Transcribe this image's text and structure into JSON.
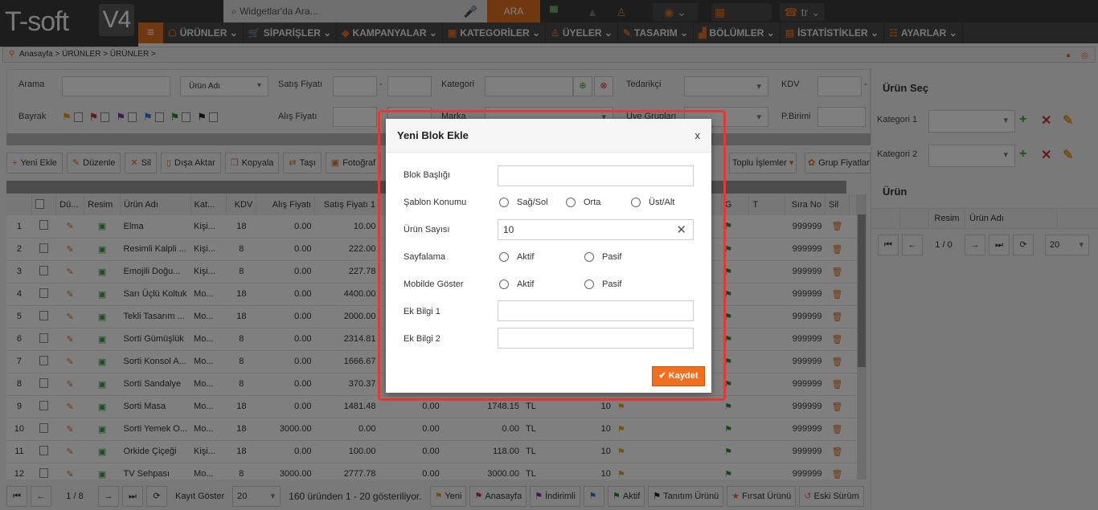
{
  "app": {
    "logo": "T-soft",
    "logo_version": "V4",
    "search_placeholder": "Widgetlar'da Ara...",
    "search_button": "ARA",
    "language": "tr"
  },
  "nav": [
    "ÜRÜNLER",
    "SİPARİŞLER",
    "KAMPANYALAR",
    "KATEGORİLER",
    "ÜYELER",
    "TASARIM",
    "BÖLÜMLER",
    "İSTATİSTİKLER",
    "AYARLAR"
  ],
  "breadcrumb": "Anasayfa > ÜRÜNLER > ÜRÜNLER >",
  "filters": {
    "arama": "Arama",
    "arama_select": "Ürün Adı",
    "satis_fiyati": "Satış Fiyatı",
    "kategori": "Kategori",
    "tedarikci": "Tedarikçi",
    "kdv": "KDV",
    "bayrak": "Bayrak",
    "alis_fiyati": "Alış Fiyatı",
    "marka": "Marka",
    "uye_gruplari": "Üye Grupları",
    "pbirimi": "P.Birimi",
    "dash": "-",
    "flag_colors": [
      "#e8a020",
      "#d03030",
      "#8a2aa8",
      "#2a7ad0",
      "#2e8b2e",
      "#222222"
    ]
  },
  "toolbar": [
    "Yeni Ekle",
    "Düzenle",
    "Sil",
    "Dışa Aktar",
    "Kopyala",
    "Taşı",
    "Fotoğraf"
  ],
  "toolbar_right": [
    "Toplu İşlemler",
    "Grup Fiyatlarını Göster"
  ],
  "table": {
    "headers": [
      "",
      "Dü...",
      "Resim",
      "Ürün Adı",
      "Kat...",
      "KDV",
      "Alış Fiyatı",
      "Satış Fiyatı 1",
      "",
      "",
      "",
      "",
      "",
      "G",
      "T",
      "Sıra No",
      "Sil"
    ],
    "rows": [
      {
        "n": "1",
        "name": "Elma",
        "kat": "Kişi...",
        "kdv": "18",
        "alis": "0.00",
        "satis": "10.00",
        "c1": "",
        "c2": "",
        "pb": "",
        "st": "",
        "sira": "999999"
      },
      {
        "n": "2",
        "name": "Resimli Kalpli ...",
        "kat": "Kişi...",
        "kdv": "8",
        "alis": "0.00",
        "satis": "222.00",
        "c1": "",
        "c2": "",
        "pb": "",
        "st": "",
        "sira": "999999"
      },
      {
        "n": "3",
        "name": "Emojili Doğu...",
        "kat": "Kişi...",
        "kdv": "8",
        "alis": "0.00",
        "satis": "227.78",
        "c1": "",
        "c2": "",
        "pb": "",
        "st": "",
        "sira": "999999"
      },
      {
        "n": "4",
        "name": "Sarı Üçlü Koltuk",
        "kat": "Mo...",
        "kdv": "18",
        "alis": "0.00",
        "satis": "4400.00",
        "c1": "",
        "c2": "",
        "pb": "",
        "st": "",
        "sira": "999999"
      },
      {
        "n": "5",
        "name": "Tekli Tasarım ...",
        "kat": "Mo...",
        "kdv": "18",
        "alis": "0.00",
        "satis": "2000.00",
        "c1": "",
        "c2": "",
        "pb": "",
        "st": "",
        "sira": "999999"
      },
      {
        "n": "6",
        "name": "Sorti Gümüşlük",
        "kat": "Mo...",
        "kdv": "8",
        "alis": "0.00",
        "satis": "2314.81",
        "c1": "",
        "c2": "",
        "pb": "",
        "st": "",
        "sira": "999999"
      },
      {
        "n": "7",
        "name": "Sorti Konsol A...",
        "kat": "Mo...",
        "kdv": "8",
        "alis": "0.00",
        "satis": "1666.67",
        "c1": "",
        "c2": "",
        "pb": "",
        "st": "",
        "sira": "999999"
      },
      {
        "n": "8",
        "name": "Sorti Sandalye",
        "kat": "Mo...",
        "kdv": "8",
        "alis": "0.00",
        "satis": "370.37",
        "c1": "",
        "c2": "",
        "pb": "",
        "st": "",
        "sira": "999999"
      },
      {
        "n": "9",
        "name": "Sorti Masa",
        "kat": "Mo...",
        "kdv": "18",
        "alis": "0.00",
        "satis": "1481.48",
        "c1": "0.00",
        "c2": "1748.15",
        "pb": "TL",
        "st": "10",
        "sira": "999999"
      },
      {
        "n": "10",
        "name": "Sorti Yemek O...",
        "kat": "Mo...",
        "kdv": "18",
        "alis": "3000.00",
        "satis": "0.00",
        "c1": "0.00",
        "c2": "0.00",
        "pb": "TL",
        "st": "10",
        "sira": "999999"
      },
      {
        "n": "11",
        "name": "Orkide Çiçeği",
        "kat": "Kişi...",
        "kdv": "18",
        "alis": "0.00",
        "satis": "100.00",
        "c1": "0.00",
        "c2": "118.00",
        "pb": "TL",
        "st": "10",
        "sira": "999999"
      },
      {
        "n": "12",
        "name": "TV Sehpası",
        "kat": "Mo...",
        "kdv": "8",
        "alis": "3000.00",
        "satis": "2777.78",
        "c1": "0.00",
        "c2": "3000.00",
        "pb": "TL",
        "st": "10",
        "sira": "999999"
      }
    ]
  },
  "pager": {
    "page": "1 / 8",
    "kayit_goster": "Kayıt Göster",
    "per_page": "20",
    "summary": "160 üründen 1 - 20 gösteriliyor.",
    "legend": [
      "Yeni",
      "Anasayfa",
      "İndirimli",
      "",
      "Aktif",
      "Tanıtım Ürünü",
      "Fırsat Ürünü",
      "Eski Sürüm"
    ]
  },
  "right_panel": {
    "title": "Ürün Seç",
    "kategori1": "Kategori 1",
    "kategori2": "Kategori 2",
    "urun": "Ürün",
    "headers": [
      "",
      "",
      "Resim",
      "Ürün Adı"
    ],
    "page": "1 / 0",
    "per_page": "20"
  },
  "modal": {
    "title": "Yeni Blok Ekle",
    "close": "x",
    "blok_basligi": "Blok Başlığı",
    "blok_basligi_value": "",
    "sablon_konumu": "Şablon Konumu",
    "sablon_options": [
      "Sağ/Sol",
      "Orta",
      "Üst/Alt"
    ],
    "urun_sayisi": "Ürün Sayısı",
    "urun_sayisi_value": "10",
    "sayfalama": "Sayfalama",
    "mobilde_goster": "Mobilde Göster",
    "aktif": "Aktif",
    "pasif": "Pasif",
    "ek_bilgi_1": "Ek Bilgi 1",
    "ek_bilgi_2": "Ek Bilgi 2",
    "save": "Kaydet"
  },
  "colors": {
    "accent": "#e07020",
    "highlight_border": "#e53935"
  }
}
